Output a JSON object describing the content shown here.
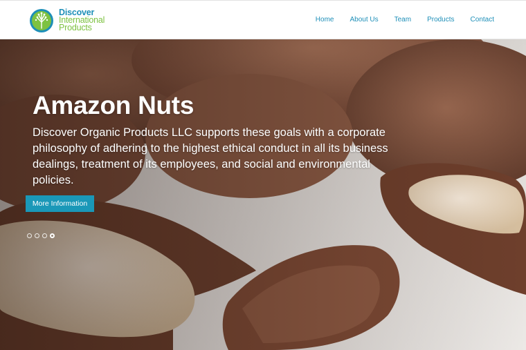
{
  "brand": {
    "line1": "Discover",
    "line2": "International",
    "line3": "Products",
    "primary_color": "#1e8fb8",
    "secondary_color": "#7dc241"
  },
  "nav": {
    "items": [
      "Home",
      "About Us",
      "Team",
      "Products",
      "Contact"
    ]
  },
  "hero": {
    "title": "Amazon Nuts",
    "text": "Discover Organic Products LLC supports these goals with a corporate philosophy of adhering to the highest ethical conduct in all its business dealings, treatment of its employees, and social and environmental policies.",
    "button_label": "More Information",
    "button_color": "#1a98b8",
    "slides_total": 4,
    "slide_active": 4
  }
}
